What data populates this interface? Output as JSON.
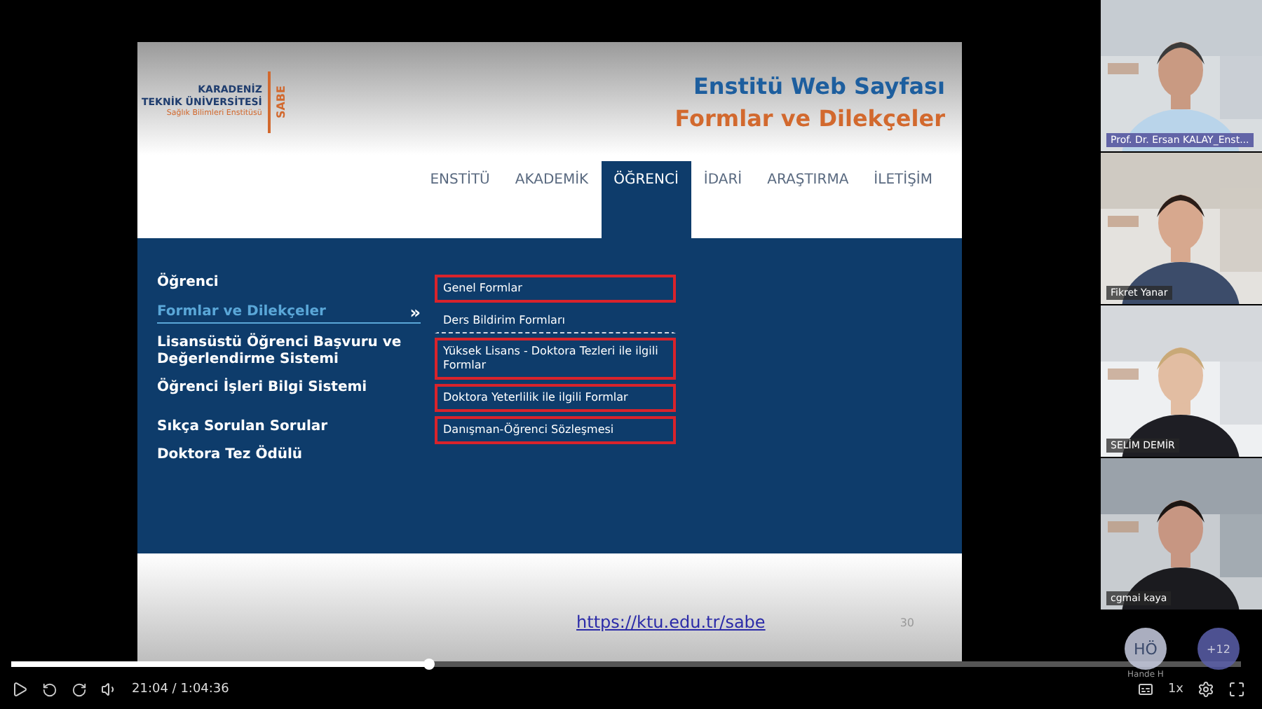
{
  "slide": {
    "logo": {
      "lines": [
        "KARADENİZ",
        "TEKNİK ÜNİVERSİTESİ",
        "Sağlık Bilimleri Enstitüsü"
      ],
      "acronym": "SABE"
    },
    "title": "Enstitü Web Sayfası",
    "subtitle": "Formlar ve Dilekçeler",
    "nav": [
      {
        "label": "ENSTİTÜ",
        "selected": false
      },
      {
        "label": "AKADEMİK",
        "selected": false
      },
      {
        "label": "ÖĞRENCİ",
        "selected": true
      },
      {
        "label": "İDARİ",
        "selected": false
      },
      {
        "label": "ARAŞTIRMA",
        "selected": false
      },
      {
        "label": "İLETİŞİM",
        "selected": false
      }
    ],
    "side_menu": [
      {
        "label": "Öğrenci",
        "selected": false
      },
      {
        "label": "Formlar ve Dilekçeler",
        "selected": true,
        "arrow": "»"
      },
      {
        "label": "Lisansüstü Öğrenci Başvuru ve Değerlendirme Sistemi",
        "selected": false
      },
      {
        "label": "Öğrenci İşleri Bilgi Sistemi",
        "selected": false
      },
      {
        "label": "Sıkça Sorulan Sorular",
        "selected": false
      },
      {
        "label": "Doktora Tez Ödülü",
        "selected": false
      }
    ],
    "submenu": [
      {
        "label": "Genel Formlar",
        "highlighted": true
      },
      {
        "label": "Ders Bildirim Formları",
        "highlighted": false
      },
      {
        "label": "Yüksek Lisans - Doktora Tezleri ile ilgili Formlar",
        "highlighted": true
      },
      {
        "label": "Doktora Yeterlilik ile ilgili Formlar",
        "highlighted": true
      },
      {
        "label": "Danışman-Öğrenci Sözleşmesi",
        "highlighted": true
      }
    ],
    "link": "https://ktu.edu.tr/sabe",
    "page_number": "30"
  },
  "participants": [
    {
      "name": "Prof. Dr. Ersan KALAY_Enst...",
      "speaking": true
    },
    {
      "name": "Fikret Yanar",
      "speaking": false
    },
    {
      "name": "SELİM DEMİR",
      "speaking": false
    },
    {
      "name": "cgmai kaya",
      "speaking": false
    }
  ],
  "avatars": [
    {
      "initials": "HÖ",
      "caption": "Hande H"
    },
    {
      "initials": "+12"
    }
  ],
  "player": {
    "time": "21:04 / 1:04:36",
    "level": 0.34,
    "speed": "1x"
  }
}
